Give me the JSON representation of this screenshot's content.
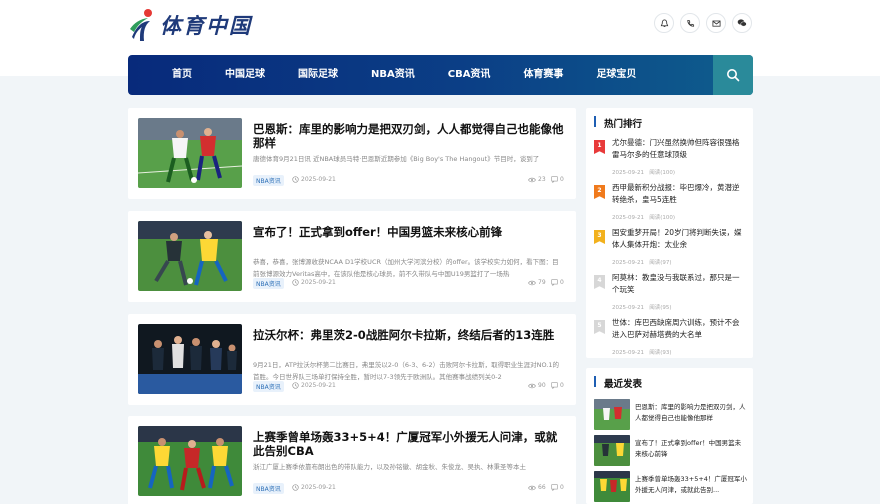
{
  "site": {
    "logo_text": "体育中国"
  },
  "top_icons": [
    "bell-icon",
    "phone-icon",
    "mail-icon",
    "wechat-icon"
  ],
  "nav": {
    "items": [
      "首页",
      "中国足球",
      "国际足球",
      "NBA资讯",
      "CBA资讯",
      "体育赛事",
      "足球宝贝"
    ],
    "search_icon": "search-icon",
    "colors": {
      "start": "#082a7b",
      "end": "#0e5e8d",
      "search_bg": "#2a8a9a"
    }
  },
  "articles": [
    {
      "title": "巴恩斯：库里的影响力是把双刃剑，人人都觉得自己也能像他那样",
      "excerpt": "唐德体育9月21日讯 近NBA球员马特·巴恩斯近期参加《Big Boy's The Hangout》节目时，谈到了",
      "tag": "NBA资讯",
      "date": "2025-09-21",
      "views": "23",
      "comments": "0"
    },
    {
      "title": "宣布了！正式拿到offer！中国男篮未来核心前锋",
      "excerpt": "恭喜，恭喜，张博源收获NCAA D1学校UCR（加州大学河滨分校）的offer。该学校实力如何，看下图：目前张博源效力Veritas高中，在该队他是核心球员，前不久带队与中国U19男篮打了一场热",
      "tag": "NBA资讯",
      "date": "2025-09-21",
      "views": "79",
      "comments": "0"
    },
    {
      "title": "拉沃尔杯：弗里茨2-0战胜阿尔卡拉斯，终结后者的13连胜",
      "excerpt": "9月21日，ATP拉沃尔杯第二比赛日，弗里茨以2-0（6-3、6-2）击败阿尔卡拉斯，取得职业生涯对NO.1的首胜。今日世界队三场单打保持全胜，暂时以7-3领先于欧洲队。其他赛事战绩列关0-2",
      "tag": "NBA资讯",
      "date": "2025-09-21",
      "views": "90",
      "comments": "0"
    },
    {
      "title": "上赛季曾单场轰33+5+4！广厦冠军小外援无人问津，或就此告别CBA",
      "excerpt": "浙江广厦上赛季依靠布朗出色的带队能力，以及孙铭徽、胡金秋、朱俊龙、吴执、林秉圣等本土",
      "tag": "NBA资讯",
      "date": "2025-09-21",
      "views": "66",
      "comments": "0"
    }
  ],
  "hot": {
    "heading": "热门排行",
    "items": [
      {
        "rank": "1",
        "color": "#e83a3a",
        "title": "尤尔曼德：门兴虽然换帅但阵容很强格雷马尔多的任意球顶级",
        "date": "2025-09-21",
        "reads": "阅读(100)"
      },
      {
        "rank": "2",
        "color": "#f07a1c",
        "title": "西甲最新积分战报：毕巴爆冷，黄潜逆转绝杀，皇马5连胜",
        "date": "2025-09-21",
        "reads": "阅读(100)"
      },
      {
        "rank": "3",
        "color": "#f2b11d",
        "title": "国安重梦开局！20岁门将判断失误，媒体人集体开炮：太业余",
        "date": "2025-09-21",
        "reads": "阅读(97)"
      },
      {
        "rank": "4",
        "color": "#d7d7d7",
        "title": "阿莫林：教皇没与我联系过，那只是一个玩笑",
        "date": "2025-09-21",
        "reads": "阅读(95)"
      },
      {
        "rank": "5",
        "color": "#d7d7d7",
        "title": "世体：库巴西缺席周六训练，预计不会进入巴萨对赫塔费的大名单",
        "date": "2025-09-21",
        "reads": "阅读(93)"
      }
    ]
  },
  "recent": {
    "heading": "最近发表",
    "items": [
      {
        "title": "巴恩斯：库里的影响力是把双刃剑，人人都觉得自己也能像他那样"
      },
      {
        "title": "宣布了！正式拿到offer！中国男篮未来核心前锋"
      },
      {
        "title": "上赛季曾单场轰33+5+4！广厦冠军小外援无人问津，或就此告别..."
      }
    ]
  }
}
